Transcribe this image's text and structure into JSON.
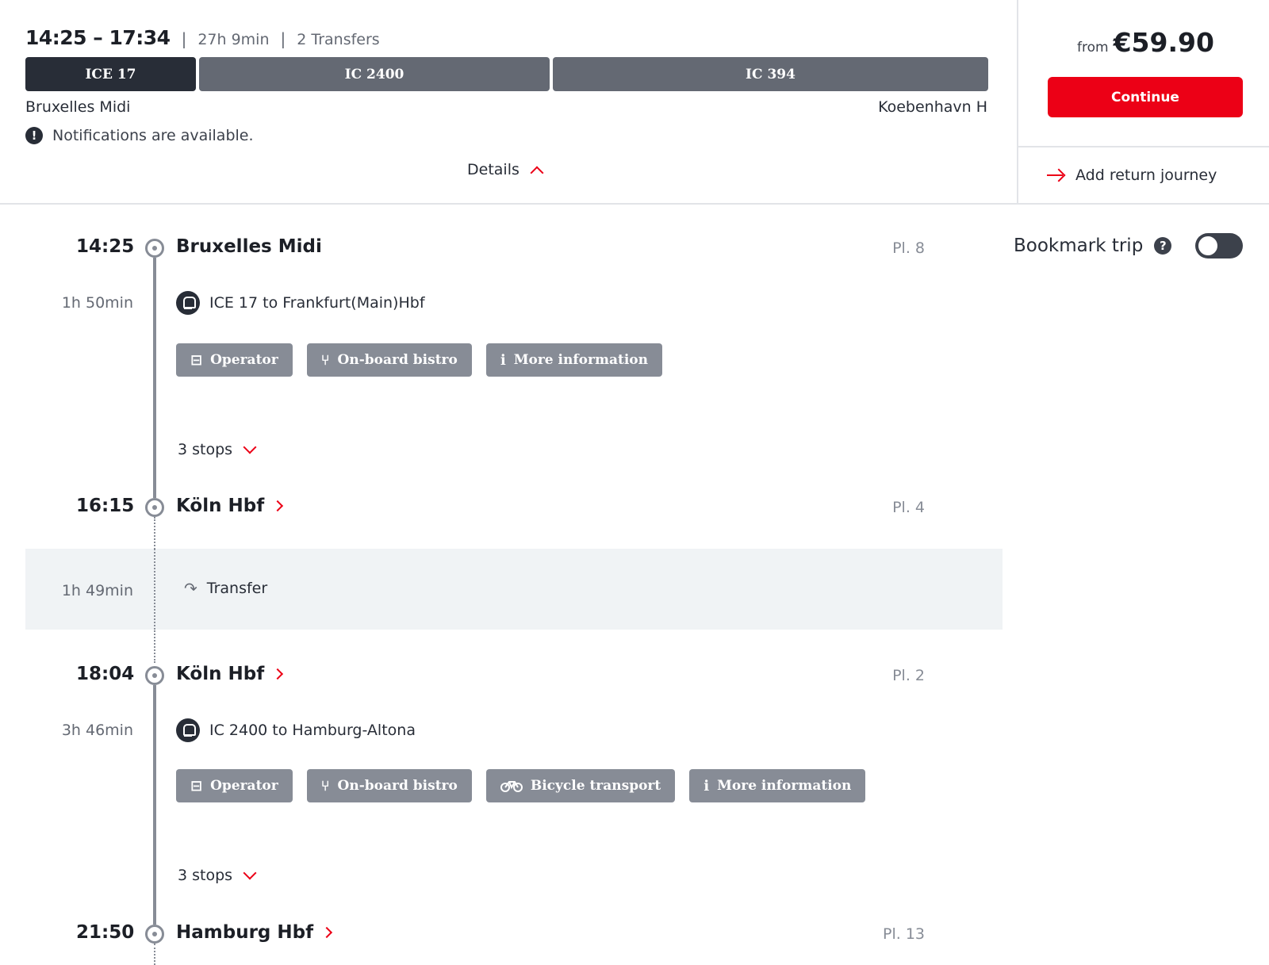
{
  "summary": {
    "times": "14:25 – 17:34",
    "duration": "27h 9min",
    "transfers": "2 Transfers",
    "separator": "|",
    "segments": [
      "ICE 17",
      "IC 2400",
      "IC 394"
    ],
    "from_station": "Bruxelles Midi",
    "to_station": "Koebenhavn H",
    "notice": "Notifications are available.",
    "details_label": "Details"
  },
  "price_panel": {
    "from_label": "from",
    "price": "€59.90",
    "continue_label": "Continue",
    "return_label": "Add return journey"
  },
  "bookmark": {
    "label": "Bookmark trip",
    "help": "?",
    "enabled": false
  },
  "timeline": {
    "stop1": {
      "time": "14:25",
      "name": "Bruxelles Midi",
      "platform": "Pl. 8"
    },
    "leg1": {
      "duration": "1h 50min",
      "train": "ICE 17 to Frankfurt(Main)Hbf",
      "chips": {
        "operator": "Operator",
        "bistro": "On-board bistro",
        "info": "More information"
      },
      "stops_label": "3 stops"
    },
    "stop2": {
      "time": "16:15",
      "name": "Köln Hbf",
      "platform": "Pl. 4"
    },
    "transfer": {
      "duration": "1h 49min",
      "label": "Transfer"
    },
    "stop3": {
      "time": "18:04",
      "name": "Köln Hbf",
      "platform": "Pl. 2"
    },
    "leg2": {
      "duration": "3h 46min",
      "train": "IC 2400 to Hamburg-Altona",
      "chips": {
        "operator": "Operator",
        "bistro": "On-board bistro",
        "bicycle": "Bicycle transport",
        "info": "More information"
      },
      "stops_label": "3 stops"
    },
    "stop4": {
      "time": "21:50",
      "name": "Hamburg Hbf",
      "platform": "Pl. 13"
    }
  },
  "icons": {
    "notice": "exclamation-circle-icon",
    "details": "chevron-up-icon",
    "return": "arrow-right-icon",
    "train": "train-icon",
    "operator": "bus-icon",
    "bistro": "cutlery-icon",
    "bicycle": "bicycle-icon",
    "info": "info-icon",
    "transfer": "transfer-icon",
    "station_link": "chevron-right-icon",
    "stops_toggle": "chevron-down-icon"
  },
  "colors": {
    "accent": "#ec0016",
    "segment_active": "#282d37",
    "segment_inactive": "#646973",
    "chip": "#878c96",
    "transfer_band": "#f0f3f5"
  }
}
